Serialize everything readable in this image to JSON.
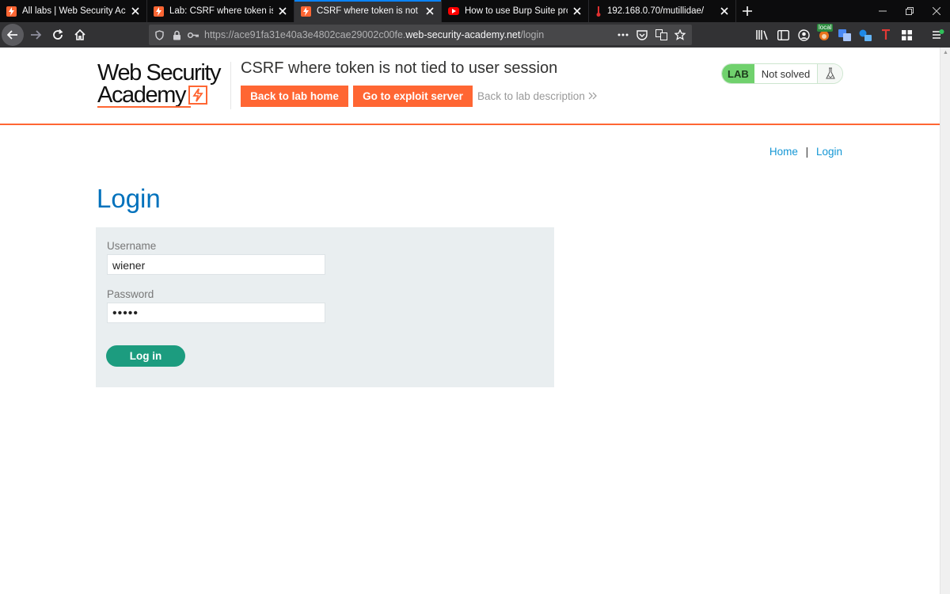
{
  "browser": {
    "tabs": [
      {
        "title": "All labs | Web Security Academy",
        "favicon": "burp-bolt-icon",
        "active": false
      },
      {
        "title": "Lab: CSRF where token is not tied",
        "favicon": "burp-bolt-icon",
        "active": false
      },
      {
        "title": "CSRF where token is not tied to user",
        "favicon": "burp-bolt-icon",
        "active": true
      },
      {
        "title": "How to use Burp Suite projects",
        "favicon": "youtube-icon",
        "active": false
      },
      {
        "title": "192.168.0.70/mutillidae/",
        "favicon": "thermometer-icon",
        "active": false
      }
    ],
    "url": {
      "prefix": "https://ace91fa31e40a3e4802cae29002c00fe.",
      "host": "web-security-academy.net",
      "path": "/login"
    },
    "extension_badge": "local"
  },
  "header": {
    "logo_line1": "Web Security",
    "logo_line2": "Academy",
    "lab_title": "CSRF where token is not tied to user session",
    "back_home_label": "Back to lab home",
    "exploit_label": "Go to exploit server",
    "back_desc_label": "Back to lab description",
    "badge_lab": "LAB",
    "badge_status": "Not solved"
  },
  "topnav": {
    "home": "Home",
    "separator": "|",
    "login": "Login"
  },
  "login": {
    "heading": "Login",
    "username_label": "Username",
    "username_value": "wiener",
    "password_label": "Password",
    "password_value": "•••••",
    "submit_label": "Log in"
  },
  "colors": {
    "accent_orange": "#ff6633",
    "heading_blue": "#0071bc",
    "login_green": "#1c9c7f",
    "lab_green": "#70d16d"
  }
}
